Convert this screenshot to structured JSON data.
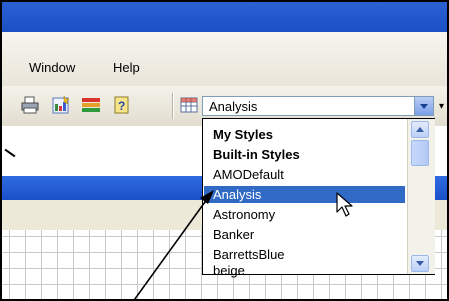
{
  "menu": {
    "items": [
      "Window",
      "Help"
    ]
  },
  "toolbar": {
    "icons": [
      "print-icon",
      "wizard-icon",
      "color-bars-icon",
      "help-book-icon",
      "table-icon"
    ],
    "styles_combo": {
      "value": "Analysis"
    },
    "overflow_glyph": "▾"
  },
  "dropdown": {
    "groups": [
      "My Styles",
      "Built-in Styles"
    ],
    "items": [
      "AMODefault",
      "Analysis",
      "Astronomy",
      "Banker",
      "BarrettsBlue",
      "beige"
    ],
    "selected": "Analysis",
    "highlight_color": "#316ac5"
  },
  "colors": {
    "title_bar": "#1c4fc4",
    "grid_line": "#c8c8c8"
  }
}
